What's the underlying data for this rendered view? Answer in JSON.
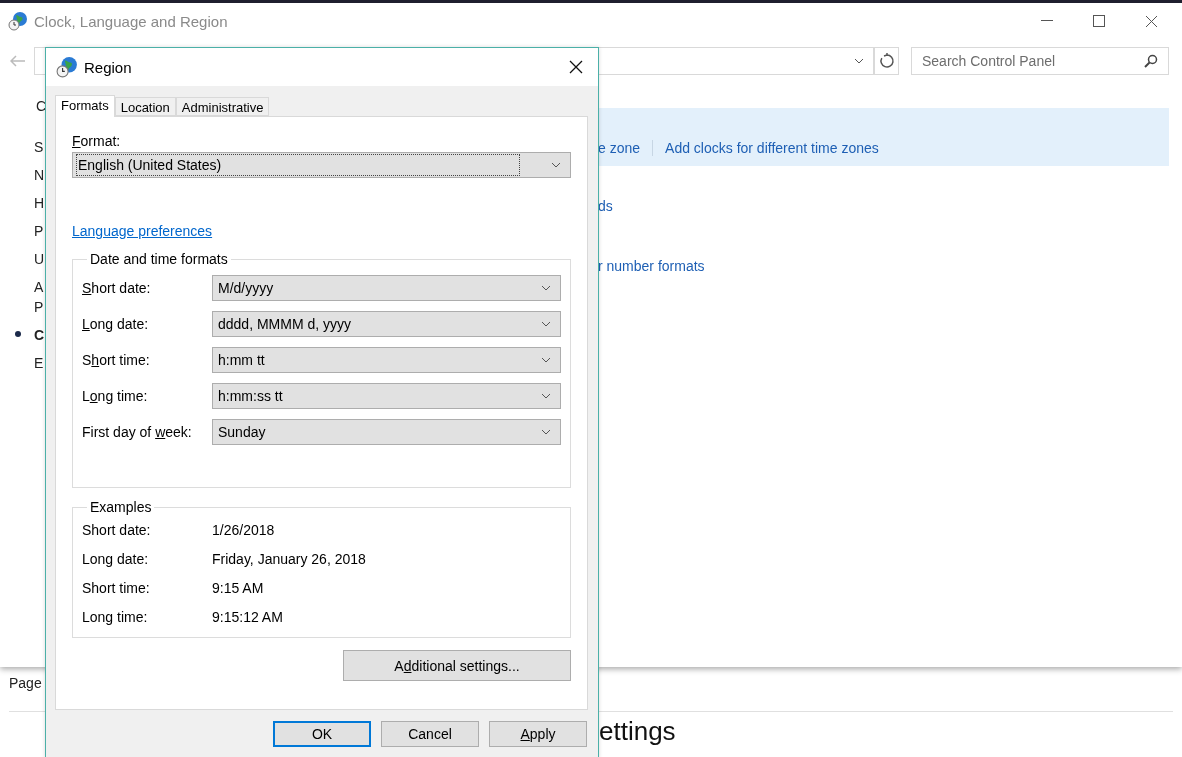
{
  "window": {
    "title": "Clock, Language and Region"
  },
  "search": {
    "placeholder": "Search Control Panel"
  },
  "sidebar": {
    "heading": "C",
    "items": [
      {
        "lines": [
          "S"
        ],
        "selected": false
      },
      {
        "lines": [
          "N"
        ],
        "selected": false
      },
      {
        "lines": [
          "H"
        ],
        "selected": false
      },
      {
        "lines": [
          "P"
        ],
        "selected": false
      },
      {
        "lines": [
          "U"
        ],
        "selected": false
      },
      {
        "lines": [
          "A",
          "P"
        ],
        "selected": false
      },
      {
        "lines": [
          "C"
        ],
        "selected": true
      },
      {
        "lines": [
          "E"
        ],
        "selected": false
      }
    ]
  },
  "banner_links": [
    "e zone",
    "Add clocks for different time zones"
  ],
  "links": [
    "ds",
    "r number formats"
  ],
  "lower": {
    "label": "Page",
    "heading": "ettings"
  },
  "dialog": {
    "title": "Region",
    "tabs": [
      {
        "label": "Formats",
        "selected": true
      },
      {
        "label": "Location",
        "selected": false
      },
      {
        "label": "Administrative",
        "selected": false
      }
    ],
    "format": {
      "label": [
        {
          "text": "F",
          "underlined": true
        },
        {
          "text": "ormat:",
          "underlined": false
        }
      ],
      "value": "English (United States)",
      "focused": true
    },
    "language_link": "Language preferences",
    "date_time": {
      "legend": "Date and time formats",
      "rows": [
        {
          "label": [
            {
              "text": "S",
              "underlined": true
            },
            {
              "text": "hort date:",
              "underlined": false
            }
          ],
          "value": "M/d/yyyy"
        },
        {
          "label": [
            {
              "text": "L",
              "underlined": true
            },
            {
              "text": "ong date:",
              "underlined": false
            }
          ],
          "value": "dddd, MMMM d, yyyy"
        },
        {
          "label": [
            {
              "text": "S",
              "underlined": false
            },
            {
              "text": "h",
              "underlined": true
            },
            {
              "text": "ort time:",
              "underlined": false
            }
          ],
          "value": "h:mm tt"
        },
        {
          "label": [
            {
              "text": "L",
              "underlined": false
            },
            {
              "text": "o",
              "underlined": true
            },
            {
              "text": "ng time:",
              "underlined": false
            }
          ],
          "value": "h:mm:ss tt"
        },
        {
          "label": [
            {
              "text": "First day of ",
              "underlined": false
            },
            {
              "text": "w",
              "underlined": true
            },
            {
              "text": "eek:",
              "underlined": false
            }
          ],
          "value": "Sunday"
        }
      ]
    },
    "examples": {
      "legend": "Examples",
      "rows": [
        {
          "label": "Short date:",
          "value": "1/26/2018"
        },
        {
          "label": "Long date:",
          "value": "Friday, January 26, 2018"
        },
        {
          "label": "Short time:",
          "value": "9:15 AM"
        },
        {
          "label": "Long time:",
          "value": "9:15:12 AM"
        }
      ]
    },
    "additional_button": {
      "label": [
        {
          "text": "A",
          "underlined": false
        },
        {
          "text": "d",
          "underlined": true
        },
        {
          "text": "ditional settings...",
          "underlined": false
        }
      ]
    },
    "buttons": [
      {
        "label": [
          {
            "text": "OK",
            "underlined": false
          }
        ],
        "default": true
      },
      {
        "label": [
          {
            "text": "Cancel",
            "underlined": false
          }
        ],
        "default": false
      },
      {
        "label": [
          {
            "text": "A",
            "underlined": true
          },
          {
            "text": "pply",
            "underlined": false
          }
        ],
        "default": false
      }
    ]
  }
}
